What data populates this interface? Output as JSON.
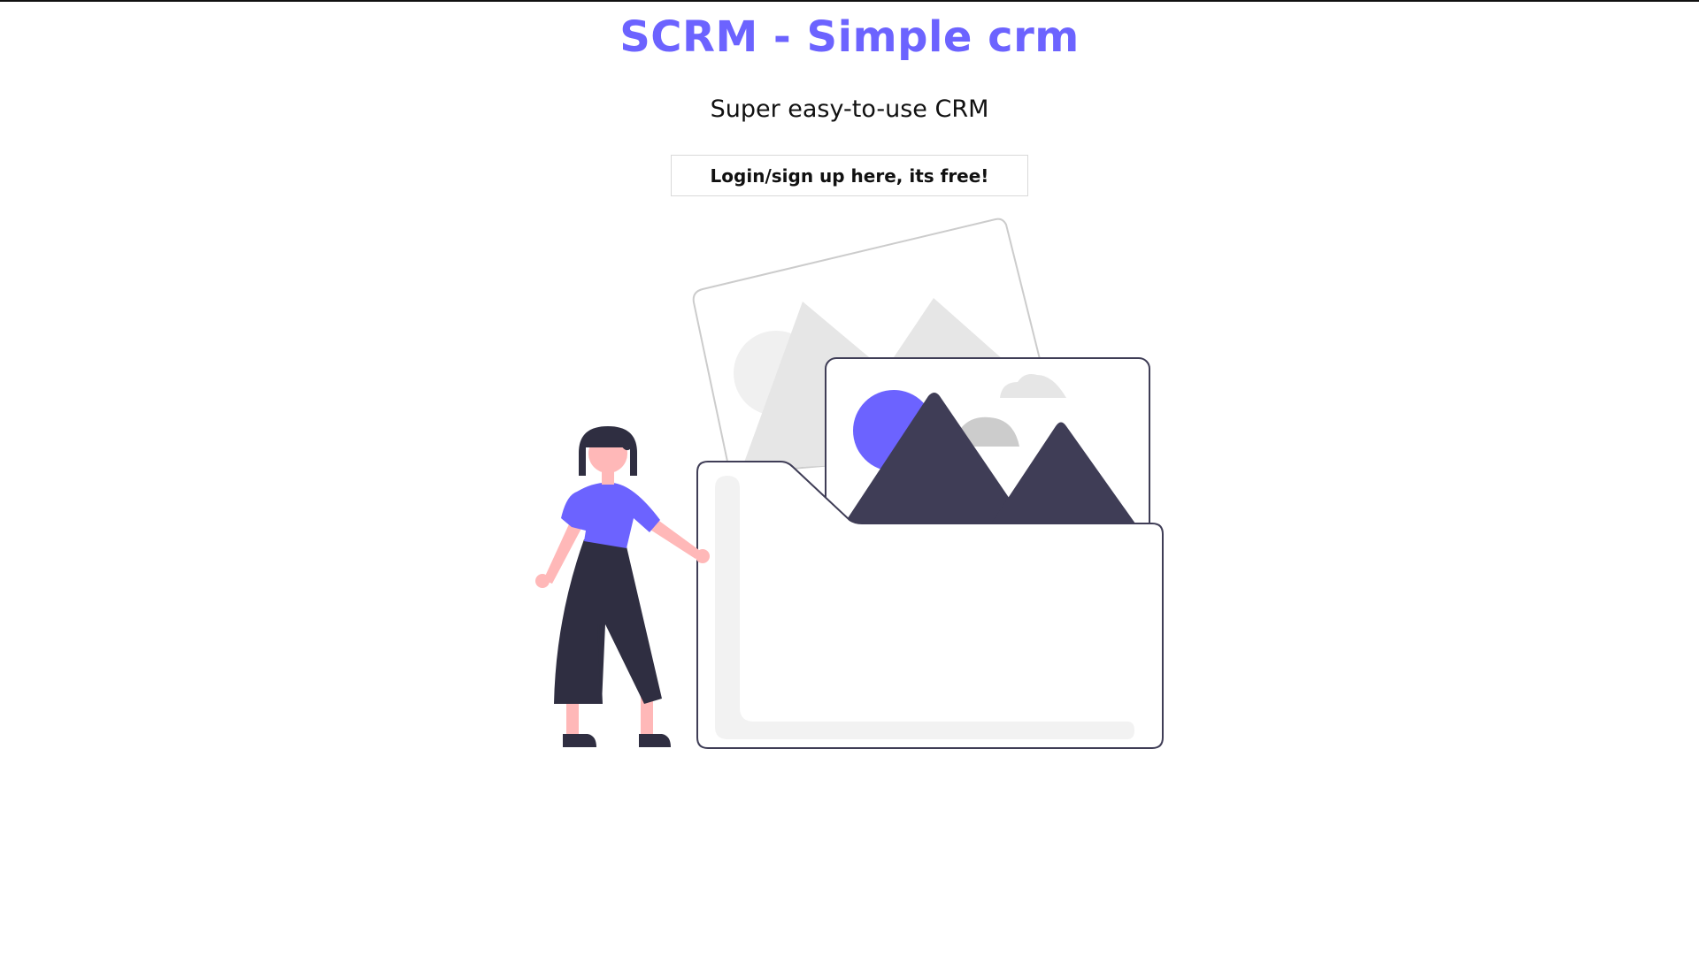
{
  "header": {
    "title": "SCRM - Simple crm",
    "subtitle": "Super easy-to-use CRM"
  },
  "cta": {
    "label": "Login/sign up here, its free!"
  },
  "colors": {
    "accent": "#6c63ff",
    "ink": "#3f3d56",
    "dark": "#2f2e41",
    "skin": "#ffb8b8",
    "light_gray": "#e6e6e6",
    "mid_gray": "#cccccc",
    "panel_gray": "#f2f2f2"
  },
  "illustration": {
    "icon": "person-with-image-folder-illustration"
  }
}
